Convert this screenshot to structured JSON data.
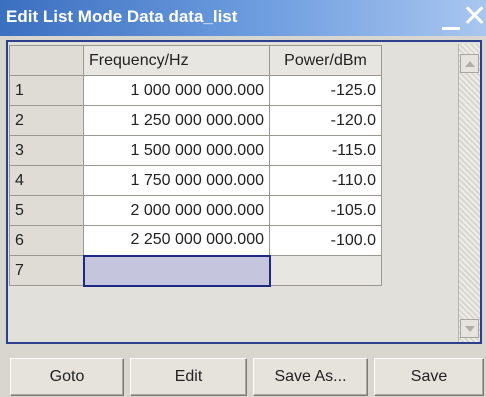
{
  "window": {
    "title": "Edit List Mode Data data_list"
  },
  "table": {
    "headers": {
      "frequency": "Frequency/Hz",
      "power": "Power/dBm"
    },
    "rows": [
      {
        "index": "1",
        "frequency": "1 000 000 000.000",
        "power": "-125.0"
      },
      {
        "index": "2",
        "frequency": "1 250 000 000.000",
        "power": "-120.0"
      },
      {
        "index": "3",
        "frequency": "1 500 000 000.000",
        "power": "-115.0"
      },
      {
        "index": "4",
        "frequency": "1 750 000 000.000",
        "power": "-110.0"
      },
      {
        "index": "5",
        "frequency": "2 000 000 000.000",
        "power": "-105.0"
      },
      {
        "index": "6",
        "frequency": "2 250 000 000.000",
        "power": "-100.0"
      },
      {
        "index": "7",
        "frequency": "",
        "power": ""
      }
    ]
  },
  "buttons": {
    "goto": "Goto",
    "edit": "Edit",
    "save_as": "Save As...",
    "save": "Save"
  }
}
